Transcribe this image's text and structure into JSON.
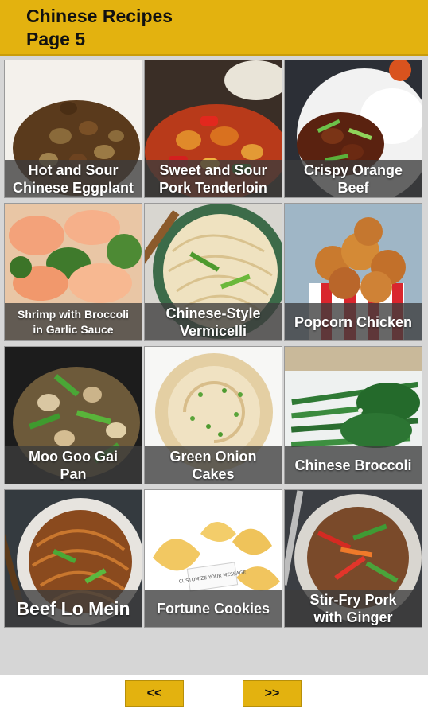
{
  "header": {
    "title_line1": "Chinese Recipes",
    "title_line2": "Page 5",
    "color": "#e3b20f"
  },
  "recipes": [
    {
      "label": "Hot and Sour Chinese Eggplant",
      "line1": "Hot and Sour",
      "line2": "Chinese Eggplant"
    },
    {
      "label": "Sweet and Sour Pork Tenderloin",
      "line1": "Sweet and Sour",
      "line2": "Pork Tenderloin"
    },
    {
      "label": "Crispy Orange Beef",
      "line1": "Crispy Orange",
      "line2": "Beef"
    },
    {
      "label": "Shrimp with Broccoli in Garlic Sauce",
      "line1": "Shrimp with Broccoli",
      "line2": "in Garlic Sauce"
    },
    {
      "label": "Chinese-Style Vermicelli",
      "line1": "Chinese-Style",
      "line2": "Vermicelli"
    },
    {
      "label": "Popcorn Chicken",
      "line1": "Popcorn Chicken",
      "line2": ""
    },
    {
      "label": "Moo Goo Gai Pan",
      "line1": "Moo Goo Gai",
      "line2": "Pan"
    },
    {
      "label": "Green Onion Cakes",
      "line1": "Green Onion",
      "line2": "Cakes"
    },
    {
      "label": "Chinese Broccoli",
      "line1": "Chinese Broccoli",
      "line2": ""
    },
    {
      "label": "Beef Lo Mein",
      "line1": "Beef Lo Mein",
      "line2": ""
    },
    {
      "label": "Fortune Cookies",
      "line1": "Fortune Cookies",
      "line2": ""
    },
    {
      "label": "Stir-Fry Pork with Ginger",
      "line1": "Stir-Fry Pork",
      "line2": "with Ginger"
    }
  ],
  "fortune_slip_text": "CUSTOMIZE YOUR MESSAGE",
  "nav": {
    "prev_label": "<<",
    "next_label": ">>"
  }
}
